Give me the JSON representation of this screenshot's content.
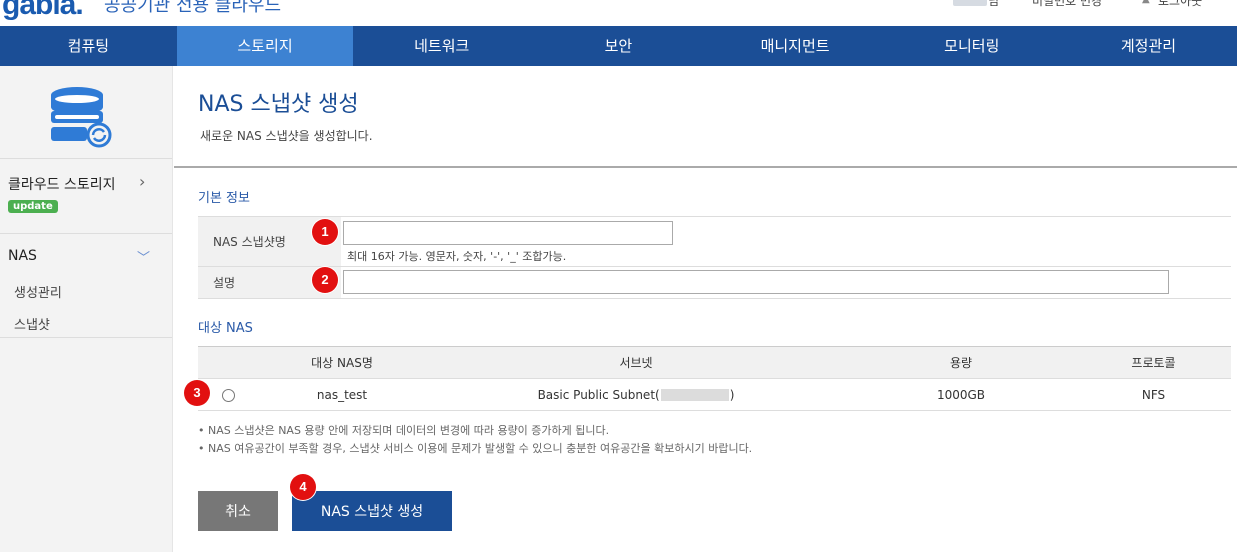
{
  "header": {
    "logo": "gabia.",
    "logo_subtitle": "공공기관 전용 클라우드",
    "user_suffix": "님",
    "change_password": "비밀번호 변경",
    "logout": "로그아웃"
  },
  "gnb": {
    "items": [
      "컴퓨팅",
      "스토리지",
      "네트워크",
      "보안",
      "매니지먼트",
      "모니터링",
      "계정관리"
    ],
    "active_index": 1
  },
  "sidebar": {
    "icon": "storage-database-icon",
    "cloud_storage": "클라우드 스토리지",
    "badge": "update",
    "nas": "NAS",
    "sub_items": [
      "생성관리",
      "스냅샷"
    ]
  },
  "page": {
    "title": "NAS 스냅샷 생성",
    "description": "새로운 NAS 스냅샷을 생성합니다."
  },
  "basic_info": {
    "section_title": "기본 정보",
    "name_label": "NAS 스냅샷명",
    "name_value": "",
    "name_hint": "최대 16자 가능. 영문자, 숫자, '-', '_' 조합가능.",
    "desc_label": "설명",
    "desc_value": ""
  },
  "target_nas": {
    "section_title": "대상 NAS",
    "columns": [
      "대상 NAS명",
      "서브넷",
      "용량",
      "프로토콜"
    ],
    "rows": [
      {
        "name": "nas_test",
        "subnet_prefix": "Basic Public Subnet(",
        "subnet_suffix": ")",
        "capacity": "1000GB",
        "protocol": "NFS",
        "selected": false
      }
    ]
  },
  "notes": [
    "• NAS 스냅샷은 NAS 용량 안에 저장되며 데이터의 변경에 따라 용량이 증가하게 됩니다.",
    "• NAS 여유공간이 부족할 경우, 스냅샷 서비스 이용에 문제가 발생할 수 있으니 충분한 여유공간을 확보하시기 바랍니다."
  ],
  "buttons": {
    "cancel": "취소",
    "create": "NAS 스냅샷 생성"
  },
  "markers": [
    "1",
    "2",
    "3",
    "4"
  ],
  "colors": {
    "gnb_bg": "#1b4e96",
    "gnb_active": "#3d82d2",
    "marker": "#e21010",
    "badge": "#4caf50"
  }
}
